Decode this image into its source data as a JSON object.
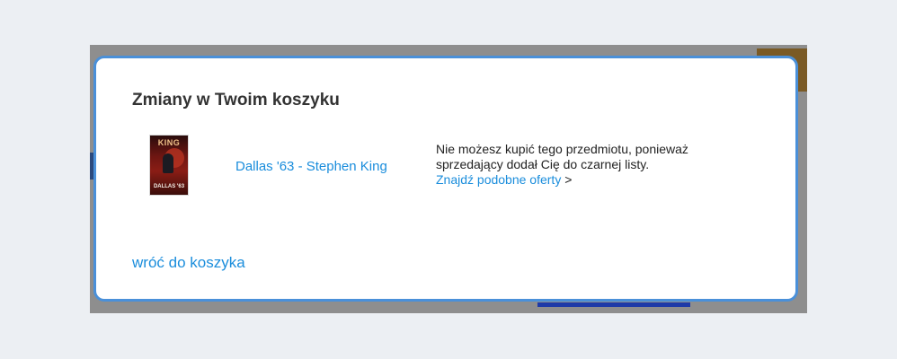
{
  "modal": {
    "title": "Zmiany w Twoim koszyku",
    "item": {
      "cover": {
        "author_text": "KING",
        "title_text": "DALLAS '63"
      },
      "product_name": "Dallas '63 - Stephen King",
      "message_line1": "Nie możesz kupić tego przedmiotu, ponieważ",
      "message_line2": "sprzedający dodał Cię do czarnej listy.",
      "similar_link": "Znajdź podobne oferty",
      "similar_suffix": ">"
    },
    "back_link": "wróć do koszyka"
  },
  "colors": {
    "link": "#1a8ddc",
    "modal_border": "#4a90d9",
    "overlay": "#8e8e8e",
    "page_background": "#eceff3"
  }
}
